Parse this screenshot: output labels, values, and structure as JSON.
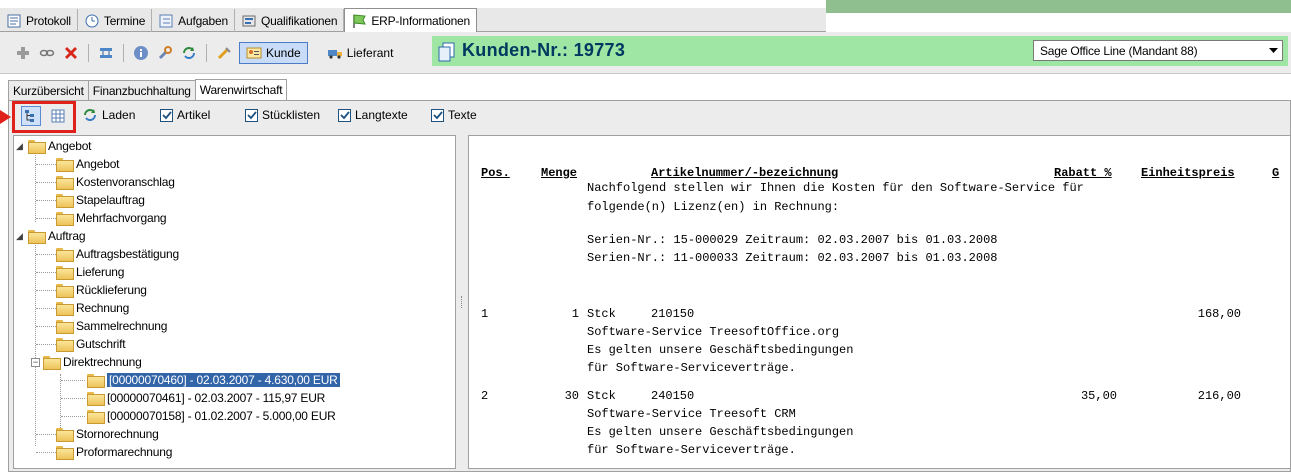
{
  "top_tabs": [
    {
      "label": "Protokoll",
      "icon": "protocol-icon"
    },
    {
      "label": "Termine",
      "icon": "calendar-icon"
    },
    {
      "label": "Aufgaben",
      "icon": "tasks-icon"
    },
    {
      "label": "Qualifikationen",
      "icon": "qualifications-icon"
    },
    {
      "label": "ERP-Informationen",
      "icon": "erp-flag-icon",
      "active": true
    }
  ],
  "toolbar": {
    "kunde_label": "Kunde",
    "lieferant_label": "Lieferant",
    "icons": [
      "add-icon",
      "link-icon",
      "delete-icon",
      "transfer-icon",
      "info-icon",
      "wrench-icon",
      "refresh-icon",
      "tools-icon"
    ]
  },
  "customer": {
    "label": "Kunden-Nr.: 19773"
  },
  "mandant_select": {
    "value": "Sage Office Line (Mandant 88)"
  },
  "sub_tabs": [
    {
      "label": "Kurzübersicht"
    },
    {
      "label": "Finanzbuchhaltung"
    },
    {
      "label": "Warenwirtschaft",
      "active": true
    }
  ],
  "inner_toolbar": {
    "laden_label": "Laden",
    "checkboxes": [
      {
        "label": "Artikel",
        "checked": true
      },
      {
        "label": "Stücklisten",
        "checked": true
      },
      {
        "label": "Langtexte",
        "checked": true
      },
      {
        "label": "Texte",
        "checked": true
      }
    ]
  },
  "tree": {
    "angebot": {
      "label": "Angebot",
      "children": [
        "Angebot",
        "Kostenvoranschlag",
        "Stapelauftrag",
        "Mehrfachvorgang"
      ]
    },
    "auftrag": {
      "label": "Auftrag",
      "children": [
        "Auftragsbestätigung",
        "Lieferung",
        "Rücklieferung",
        "Rechnung",
        "Sammelrechnung",
        "Gutschrift"
      ]
    },
    "direktrechnung": {
      "label": "Direktrechnung",
      "children": [
        "[00000070460] - 02.03.2007 - 4.630,00 EUR",
        "[00000070461] - 02.03.2007 - 115,97 EUR",
        "[00000070158] - 01.02.2007 - 5.000,00 EUR"
      ]
    },
    "after": [
      "Stornorechnung",
      "Proformarechnung"
    ]
  },
  "document": {
    "headers": {
      "pos": "Pos.",
      "menge": "Menge",
      "artikel": "Artikelnummer/-bezeichnung",
      "rabatt": "Rabatt %",
      "einheitspreis": "Einheitspreis",
      "g": "G"
    },
    "intro": [
      "Nachfolgend stellen wir Ihnen die Kosten für den Software-Service für",
      "folgende(n) Lizenz(en) in Rechnung:",
      "Serien-Nr.: 15-000029 Zeitraum: 02.03.2007 bis 01.03.2008",
      "Serien-Nr.: 11-000033 Zeitraum: 02.03.2007 bis 01.03.2008"
    ],
    "positions": [
      {
        "pos": "1",
        "menge": "1",
        "einheit": "Stck",
        "artikelnr": "210150",
        "rabatt": "",
        "preis": "168,00",
        "lines": [
          "Software-Service TreesoftOffice.org",
          "Es gelten unsere Geschäftsbedingungen",
          "für Software-Serviceverträge."
        ]
      },
      {
        "pos": "2",
        "menge": "30",
        "einheit": "Stck",
        "artikelnr": "240150",
        "rabatt": "35,00",
        "preis": "216,00",
        "lines": [
          "Software-Service Treesoft CRM",
          "Es gelten unsere Geschäftsbedingungen",
          "für Software-Serviceverträge."
        ]
      }
    ]
  }
}
